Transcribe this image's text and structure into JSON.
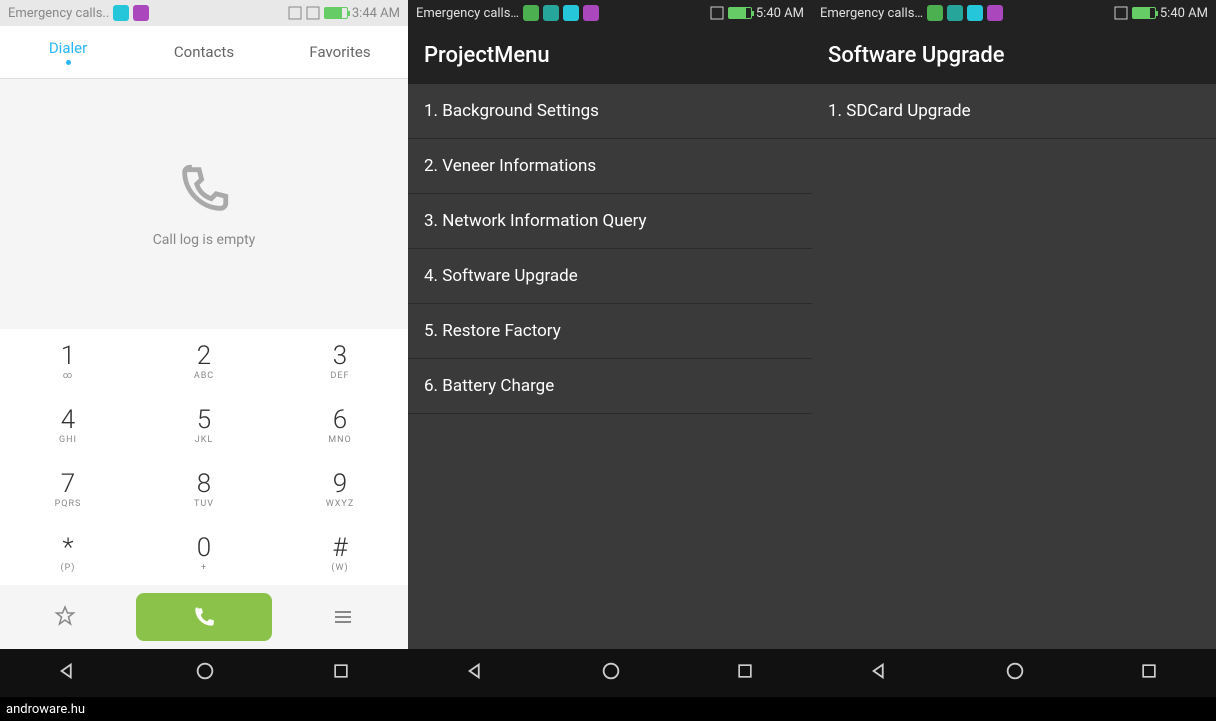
{
  "watermark": "androware.hu",
  "panel1": {
    "statusbar": {
      "carrier": "Emergency calls..",
      "time": "3:44 AM"
    },
    "tabs": [
      {
        "label": "Dialer",
        "active": true
      },
      {
        "label": "Contacts",
        "active": false
      },
      {
        "label": "Favorites",
        "active": false
      }
    ],
    "empty_message": "Call log is empty",
    "keypad": [
      [
        {
          "digit": "1",
          "letters": "∞"
        },
        {
          "digit": "2",
          "letters": "ABC"
        },
        {
          "digit": "3",
          "letters": "DEF"
        }
      ],
      [
        {
          "digit": "4",
          "letters": "GHI"
        },
        {
          "digit": "5",
          "letters": "JKL"
        },
        {
          "digit": "6",
          "letters": "MNO"
        }
      ],
      [
        {
          "digit": "7",
          "letters": "PQRS"
        },
        {
          "digit": "8",
          "letters": "TUV"
        },
        {
          "digit": "9",
          "letters": "WXYZ"
        }
      ],
      [
        {
          "digit": "*",
          "letters": "(P)"
        },
        {
          "digit": "0",
          "letters": "+"
        },
        {
          "digit": "#",
          "letters": "(W)"
        }
      ]
    ]
  },
  "panel2": {
    "statusbar": {
      "carrier": "Emergency calls…",
      "time": "5:40 AM"
    },
    "title": "ProjectMenu",
    "items": [
      "1. Background Settings",
      "2. Veneer Informations",
      "3. Network Information Query",
      "4. Software Upgrade",
      "5. Restore Factory",
      "6. Battery Charge"
    ]
  },
  "panel3": {
    "statusbar": {
      "carrier": "Emergency calls…",
      "time": "5:40 AM"
    },
    "title": "Software Upgrade",
    "items": [
      "1. SDCard Upgrade"
    ]
  }
}
